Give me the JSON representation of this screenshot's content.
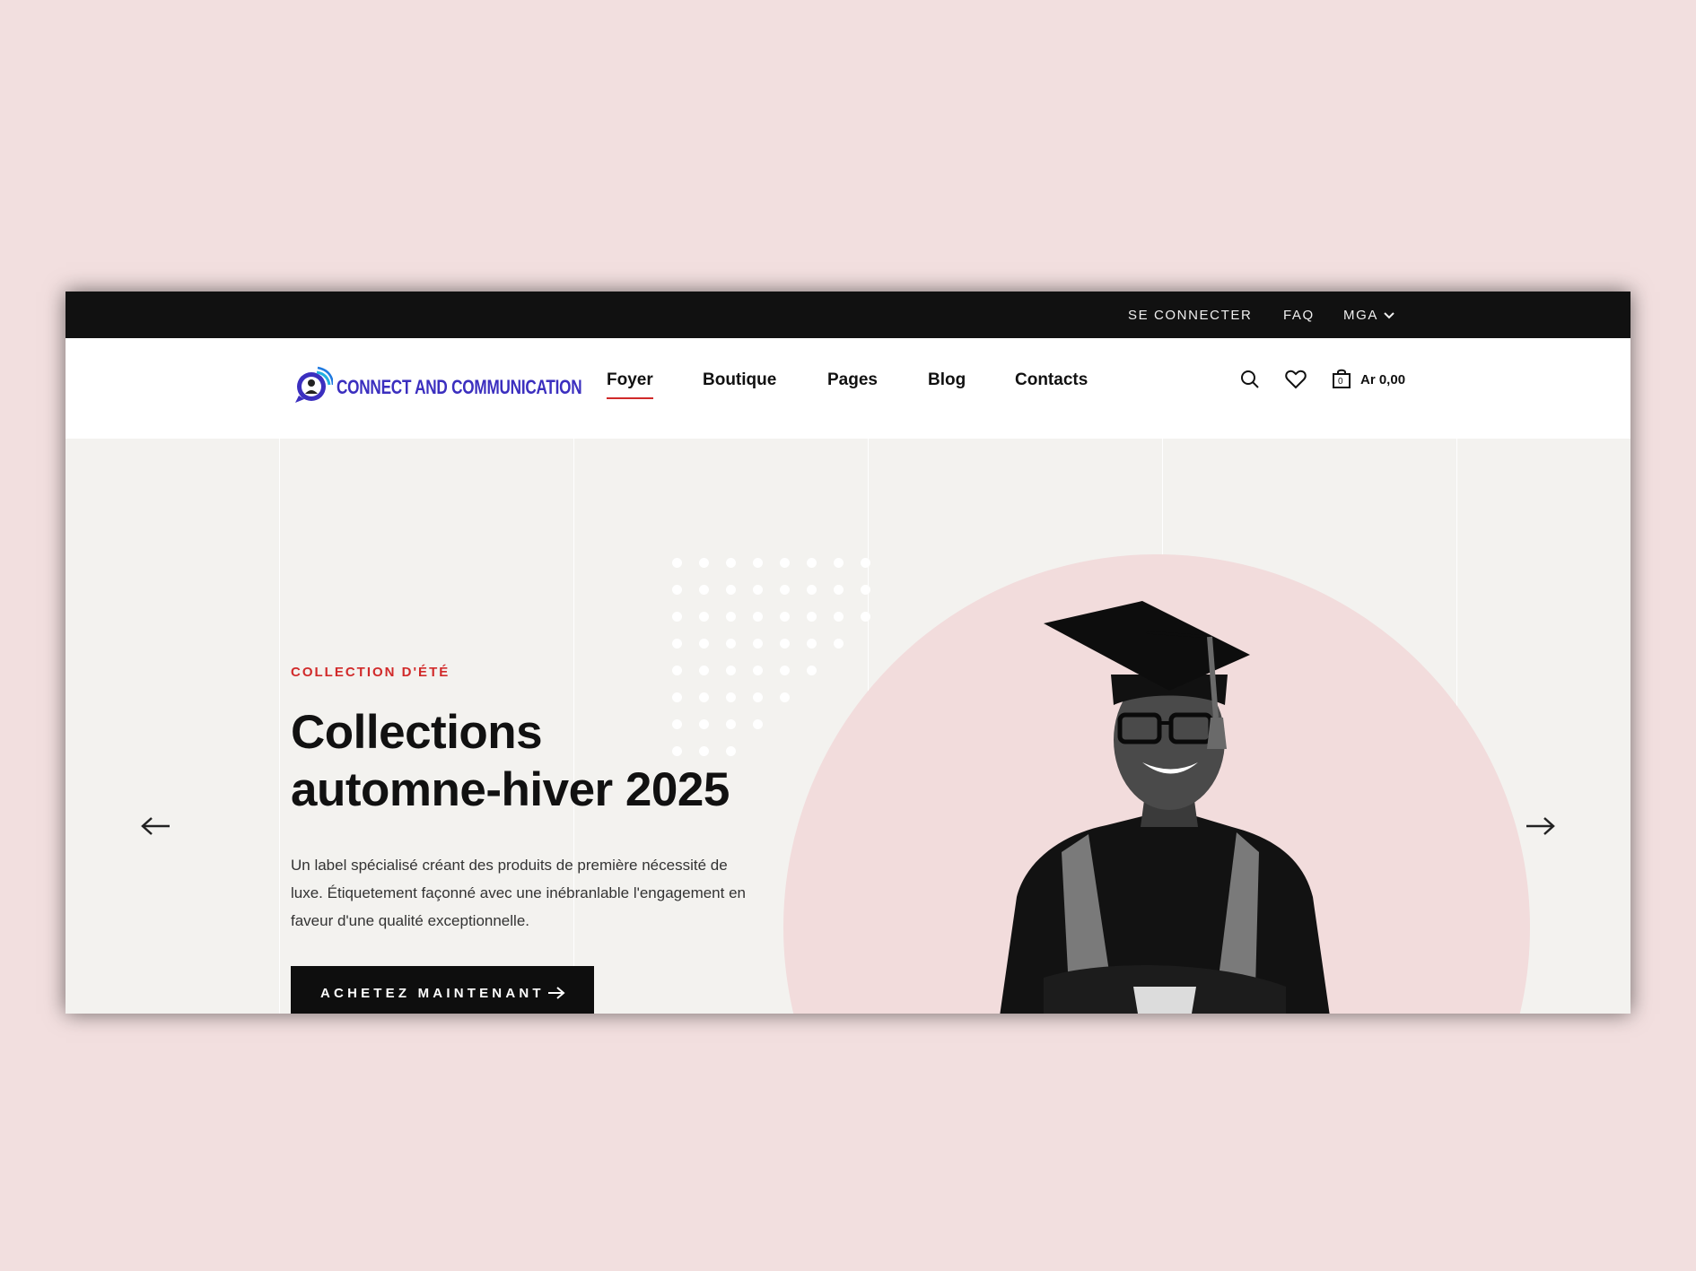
{
  "topbar": {
    "login_label": "SE CONNECTER",
    "faq_label": "FAQ",
    "currency_label": "MGA"
  },
  "header": {
    "logo_text": "CONNECT AND COMMUNICATION",
    "nav": [
      "Foyer",
      "Boutique",
      "Pages",
      "Blog",
      "Contacts"
    ],
    "active_nav": "Foyer",
    "cart_count": "0",
    "cart_total": "Ar 0,00"
  },
  "icons": [
    "search-icon",
    "heart-icon",
    "shopping-bag-icon",
    "chevron-down-icon",
    "arrow-left-icon",
    "arrow-right-icon",
    "arrow-right-icon"
  ],
  "hero": {
    "eyebrow": "COLLECTION D'ÉTÉ",
    "title_line1": "Collections",
    "title_line2": "automne-hiver 2025",
    "description": "Un label spécialisé créant des produits de première nécessité de luxe. Étiquetement façonné avec une inébranlable l'engagement en faveur d'une qualité exceptionnelle.",
    "cta_label": "ACHETEZ MAINTENANT"
  },
  "colors": {
    "page_background": "#f2dfdf",
    "topbar": "#111111",
    "hero_background": "#f3f2ef",
    "accent_red": "#d12a2a",
    "circle_pink": "#f2dcdc",
    "logo_blue": "#3b2fbf"
  }
}
